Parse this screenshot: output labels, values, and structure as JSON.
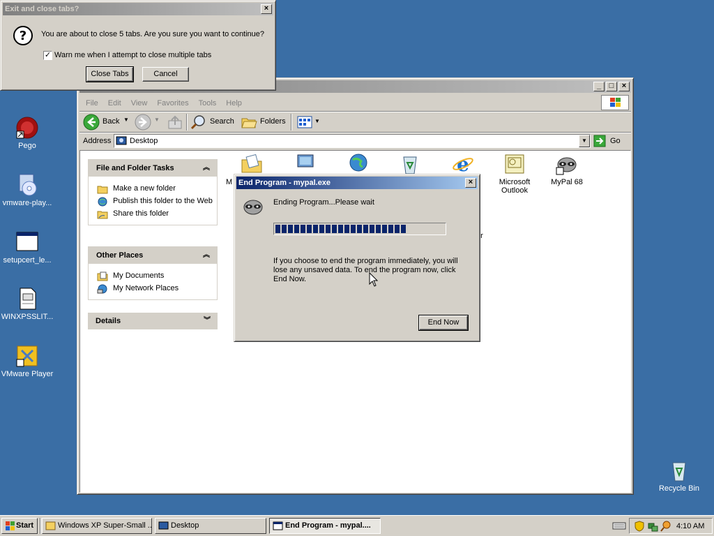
{
  "desktop": {
    "icons": [
      {
        "label": "Pego"
      },
      {
        "label": "vmware-play..."
      },
      {
        "label": "setupcert_le..."
      },
      {
        "label": "WINXPSSLIT..."
      },
      {
        "label": "VMware Player"
      },
      {
        "label": "Recycle Bin"
      }
    ]
  },
  "exit_dialog": {
    "title": "Exit and close tabs?",
    "message": "You are about to close 5 tabs. Are you sure you want to continue?",
    "checkbox_label": "Warn me when I attempt to close multiple tabs",
    "checkbox_checked": true,
    "close_tabs_label": "Close Tabs",
    "cancel_label": "Cancel"
  },
  "explorer": {
    "menu": [
      "File",
      "Edit",
      "View",
      "Favorites",
      "Tools",
      "Help"
    ],
    "toolbar": {
      "back": "Back",
      "search": "Search",
      "folders": "Folders"
    },
    "address_label": "Address",
    "address_value": "Desktop",
    "go_label": "Go",
    "file_tasks": {
      "title": "File and Folder Tasks",
      "items": [
        "Make a new folder",
        "Publish this folder to the Web",
        "Share this folder"
      ]
    },
    "other_places": {
      "title": "Other Places",
      "items": [
        "My Documents",
        "My Network Places"
      ]
    },
    "details": {
      "title": "Details"
    },
    "icons": [
      {
        "label": "M"
      },
      {
        "label": "Microsoft Outlook"
      },
      {
        "label": "MyPal 68"
      },
      {
        "label": "er"
      }
    ]
  },
  "end_program": {
    "title": "End Program - mypal.exe",
    "status": "Ending Program...Please wait",
    "progress": 0.78,
    "warning": "If you choose to end the program immediately, you will lose any unsaved data. To end the program now, click End Now.",
    "end_now_label": "End Now"
  },
  "taskbar": {
    "start_label": "Start",
    "buttons": [
      {
        "label": "Windows XP Super-Small ..."
      },
      {
        "label": "Desktop"
      },
      {
        "label": "End Program - mypal...."
      }
    ],
    "clock": "4:10 AM"
  },
  "colors": {
    "desktop": "#3a6ea5",
    "title_active": "#0a246a",
    "progress": "#0a246a"
  }
}
